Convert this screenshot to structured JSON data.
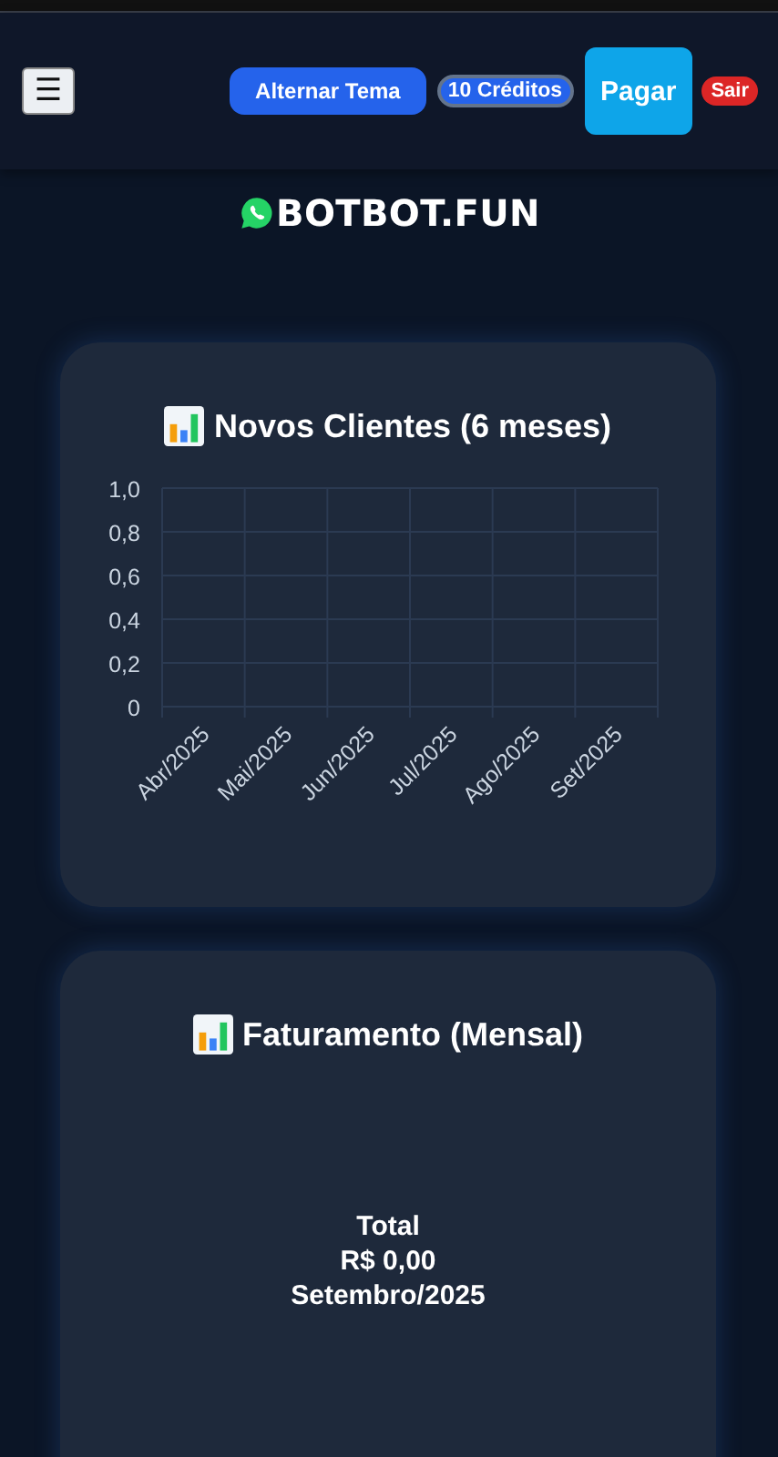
{
  "header": {
    "menu_button": "☰",
    "buttons": [
      {
        "kind": "theme",
        "label": "Alternar Tema"
      },
      {
        "kind": "credits",
        "label": "10 Créditos"
      },
      {
        "kind": "pay",
        "label": "Pagar"
      },
      {
        "kind": "logout",
        "label": "Sair"
      }
    ]
  },
  "logo": {
    "text": "BOTBOT.FUN"
  },
  "cards": [
    {
      "kind": "chart",
      "title": "Novos Clientes (6 meses)",
      "chart_data": {
        "type": "bar",
        "categories": [
          "Abr/2025",
          "Mai/2025",
          "Jun/2025",
          "Jul/2025",
          "Ago/2025",
          "Set/2025"
        ],
        "ylim": [
          0,
          1
        ],
        "yticks": [
          {
            "value": 0,
            "label": "0"
          },
          {
            "value": 0.2,
            "label": "0,2"
          },
          {
            "value": 0.4,
            "label": "0,4"
          },
          {
            "value": 0.6,
            "label": "0,6"
          },
          {
            "value": 0.8,
            "label": "0,8"
          },
          {
            "value": 1,
            "label": "1,0"
          }
        ],
        "grid": true
      }
    },
    {
      "kind": "summary",
      "title": "Faturamento (Mensal)",
      "lines": [
        "Total",
        "R$ 0,00",
        "Setembro/2025"
      ]
    }
  ]
}
